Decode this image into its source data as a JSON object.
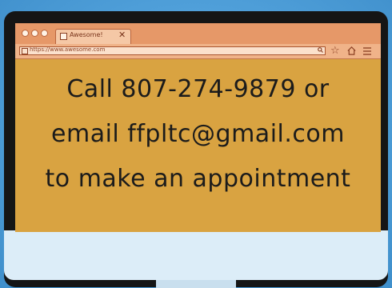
{
  "browser": {
    "tab_title": "Awesome!",
    "tab_close": "✕",
    "url": "https://www.awesome.com",
    "icons": [
      "window-dot-icon",
      "tab-favicon-icon",
      "close-icon",
      "search-icon",
      "star-icon",
      "home-icon",
      "menu-icon"
    ]
  },
  "message": {
    "line1": "Call 807-274-9879 or",
    "line2": "email ffpltc@gmail.com",
    "line3": "to make an appointment"
  },
  "colors": {
    "background": "#4f9fd9",
    "screen": "#d9a341",
    "tabbar": "#e69868",
    "text": "#1b1b1b"
  }
}
